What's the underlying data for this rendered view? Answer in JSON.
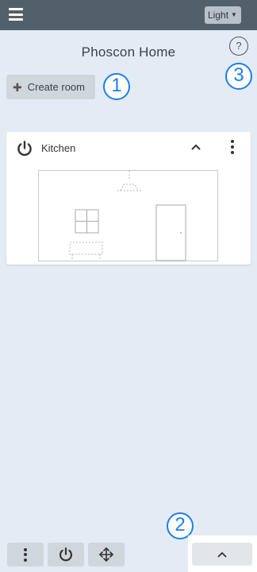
{
  "header": {
    "menu_icon": "hamburger-icon",
    "theme_select": {
      "value": "Light",
      "icon": "chevron-down-icon"
    }
  },
  "page": {
    "title": "Phoscon Home",
    "help_label": "?"
  },
  "toolbar": {
    "create_room_label": "Create room",
    "create_room_icon": "plus-icon"
  },
  "rooms": [
    {
      "name": "Kitchen",
      "power_icon": "power-icon",
      "collapse_icon": "chevron-up-icon",
      "menu_icon": "more-vertical-icon"
    }
  ],
  "annotations": {
    "marker1": "1",
    "marker2": "2",
    "marker3": "3",
    "color": "#1e7df0"
  },
  "bottom_bar": {
    "icons": [
      "more-vertical-icon",
      "power-icon",
      "move-arrows-icon"
    ],
    "expand_icon": "chevron-up-icon"
  },
  "colors": {
    "header_bg": "#52606b",
    "page_bg": "#e3ecf4",
    "button_bg": "#cfd6dc",
    "card_bg": "#ffffff"
  }
}
